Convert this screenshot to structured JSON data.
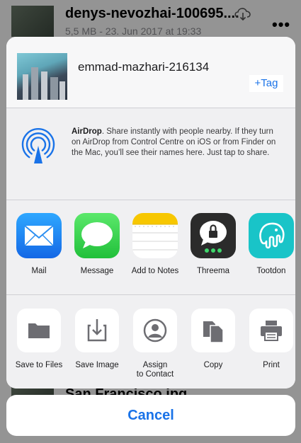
{
  "background": {
    "top_item": {
      "title": "denys-nevozhai-100695....",
      "subtitle": "5,5 MB - 23. Jun 2017 at 19:33",
      "more": "•••"
    },
    "bottom_item": {
      "title": "San Francisco.jpg"
    }
  },
  "header": {
    "file_name": "emmad-mazhari-216134",
    "tag_label": "+Tag"
  },
  "airdrop": {
    "name": "AirDrop",
    "description": ". Share instantly with people nearby. If they turn on AirDrop from Control Centre on iOS or from Finder on the Mac, you’ll see their names here. Just tap to share."
  },
  "apps": [
    {
      "label": "Mail",
      "icon": "mail-icon"
    },
    {
      "label": "Message",
      "icon": "message-icon"
    },
    {
      "label": "Add to Notes",
      "icon": "notes-icon"
    },
    {
      "label": "Threema",
      "icon": "threema-icon"
    },
    {
      "label": "Tootdon",
      "icon": "tootdon-icon"
    }
  ],
  "actions": [
    {
      "label": "Save to Files",
      "icon": "folder-icon"
    },
    {
      "label": "Save Image",
      "icon": "save-image-icon"
    },
    {
      "label": "Assign\nto Contact",
      "icon": "contact-icon"
    },
    {
      "label": "Copy",
      "icon": "copy-icon"
    },
    {
      "label": "Print",
      "icon": "print-icon"
    }
  ],
  "cancel_label": "Cancel",
  "colors": {
    "accent": "#1a73e8",
    "mail": "#1e88f5",
    "message": "#34c759",
    "notes": "#f7c700",
    "threema": "#2b2b2b",
    "tootdon": "#19c4c8"
  }
}
